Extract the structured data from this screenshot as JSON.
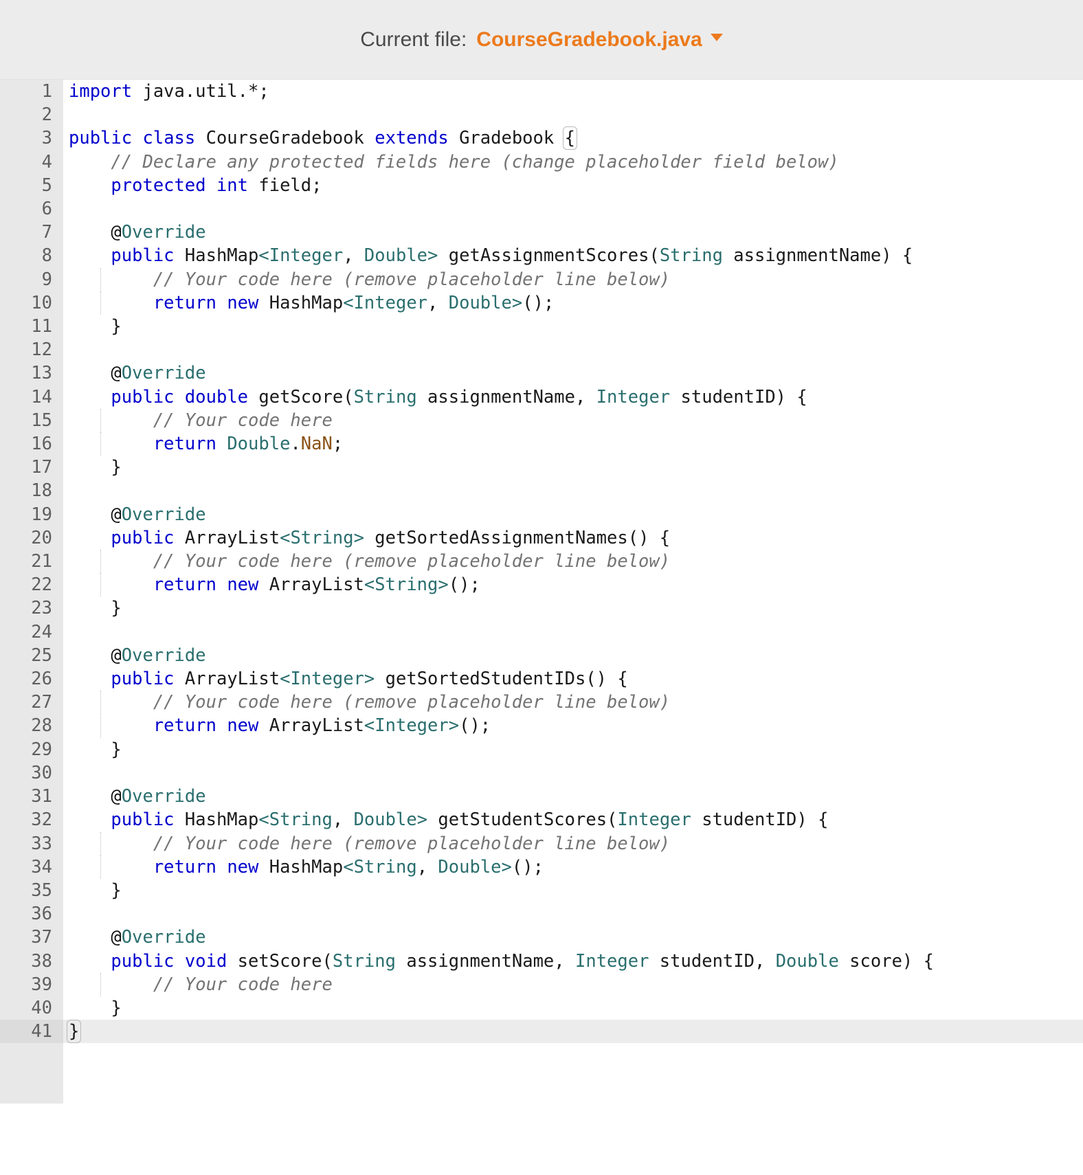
{
  "header": {
    "label": "Current file:",
    "file_name": "CourseGradebook.java",
    "caret_icon": "chevron-down-icon",
    "accent_color": "#ec7a1c",
    "background_color": "#ececec"
  },
  "editor": {
    "language": "java",
    "total_lines": 41,
    "active_line": 41,
    "gutter_background": "#e8e8e8",
    "colors": {
      "keyword": "#0000cd",
      "type": "#2a6e6e",
      "annotation": "#2a6e6e",
      "comment": "#737373",
      "constant": "#8a5316",
      "plain": "#1a1a1a"
    },
    "lines": [
      {
        "n": 1,
        "tokens": [
          {
            "t": "import",
            "c": "kw"
          },
          {
            "t": " java.util.*;",
            "c": "nrm"
          }
        ]
      },
      {
        "n": 2,
        "tokens": []
      },
      {
        "n": 3,
        "tokens": [
          {
            "t": "public",
            "c": "kw"
          },
          {
            "t": " ",
            "c": "nrm"
          },
          {
            "t": "class",
            "c": "kw"
          },
          {
            "t": " CourseGradebook ",
            "c": "nrm"
          },
          {
            "t": "extends",
            "c": "kw"
          },
          {
            "t": " Gradebook ",
            "c": "nrm"
          },
          {
            "t": "{",
            "c": "brk"
          }
        ]
      },
      {
        "n": 4,
        "tokens": [
          {
            "t": "    // Declare any protected fields here (change placeholder field below)",
            "c": "cmt"
          }
        ]
      },
      {
        "n": 5,
        "tokens": [
          {
            "t": "    ",
            "c": "nrm"
          },
          {
            "t": "protected",
            "c": "kw"
          },
          {
            "t": " ",
            "c": "nrm"
          },
          {
            "t": "int",
            "c": "kw"
          },
          {
            "t": " field;",
            "c": "nrm"
          }
        ]
      },
      {
        "n": 6,
        "tokens": []
      },
      {
        "n": 7,
        "tokens": [
          {
            "t": "    ",
            "c": "nrm"
          },
          {
            "t": "@",
            "c": "at"
          },
          {
            "t": "Override",
            "c": "ann"
          }
        ]
      },
      {
        "n": 8,
        "tokens": [
          {
            "t": "    ",
            "c": "nrm"
          },
          {
            "t": "public",
            "c": "kw"
          },
          {
            "t": " HashMap",
            "c": "nrm"
          },
          {
            "t": "<",
            "c": "typ"
          },
          {
            "t": "Integer",
            "c": "typ"
          },
          {
            "t": ", ",
            "c": "nrm"
          },
          {
            "t": "Double",
            "c": "typ"
          },
          {
            "t": ">",
            "c": "typ"
          },
          {
            "t": " getAssignmentScores(",
            "c": "nrm"
          },
          {
            "t": "String",
            "c": "typ"
          },
          {
            "t": " assignmentName) {",
            "c": "nrm"
          }
        ]
      },
      {
        "n": 9,
        "tokens": [
          {
            "t": "        // Your code here (remove placeholder line below)",
            "c": "cmt"
          }
        ]
      },
      {
        "n": 10,
        "tokens": [
          {
            "t": "        ",
            "c": "nrm"
          },
          {
            "t": "return",
            "c": "kw"
          },
          {
            "t": " ",
            "c": "nrm"
          },
          {
            "t": "new",
            "c": "kw"
          },
          {
            "t": " HashMap",
            "c": "nrm"
          },
          {
            "t": "<",
            "c": "typ"
          },
          {
            "t": "Integer",
            "c": "typ"
          },
          {
            "t": ", ",
            "c": "nrm"
          },
          {
            "t": "Double",
            "c": "typ"
          },
          {
            "t": ">",
            "c": "typ"
          },
          {
            "t": "();",
            "c": "nrm"
          }
        ]
      },
      {
        "n": 11,
        "tokens": [
          {
            "t": "    }",
            "c": "nrm"
          }
        ]
      },
      {
        "n": 12,
        "tokens": []
      },
      {
        "n": 13,
        "tokens": [
          {
            "t": "    ",
            "c": "nrm"
          },
          {
            "t": "@",
            "c": "at"
          },
          {
            "t": "Override",
            "c": "ann"
          }
        ]
      },
      {
        "n": 14,
        "tokens": [
          {
            "t": "    ",
            "c": "nrm"
          },
          {
            "t": "public",
            "c": "kw"
          },
          {
            "t": " ",
            "c": "nrm"
          },
          {
            "t": "double",
            "c": "kw"
          },
          {
            "t": " getScore(",
            "c": "nrm"
          },
          {
            "t": "String",
            "c": "typ"
          },
          {
            "t": " assignmentName, ",
            "c": "nrm"
          },
          {
            "t": "Integer",
            "c": "typ"
          },
          {
            "t": " studentID) {",
            "c": "nrm"
          }
        ]
      },
      {
        "n": 15,
        "tokens": [
          {
            "t": "        // Your code here",
            "c": "cmt"
          }
        ]
      },
      {
        "n": 16,
        "tokens": [
          {
            "t": "        ",
            "c": "nrm"
          },
          {
            "t": "return",
            "c": "kw"
          },
          {
            "t": " ",
            "c": "nrm"
          },
          {
            "t": "Double",
            "c": "typ"
          },
          {
            "t": ".",
            "c": "nrm"
          },
          {
            "t": "NaN",
            "c": "cst"
          },
          {
            "t": ";",
            "c": "nrm"
          }
        ]
      },
      {
        "n": 17,
        "tokens": [
          {
            "t": "    }",
            "c": "nrm"
          }
        ]
      },
      {
        "n": 18,
        "tokens": []
      },
      {
        "n": 19,
        "tokens": [
          {
            "t": "    ",
            "c": "nrm"
          },
          {
            "t": "@",
            "c": "at"
          },
          {
            "t": "Override",
            "c": "ann"
          }
        ]
      },
      {
        "n": 20,
        "tokens": [
          {
            "t": "    ",
            "c": "nrm"
          },
          {
            "t": "public",
            "c": "kw"
          },
          {
            "t": " ArrayList",
            "c": "nrm"
          },
          {
            "t": "<",
            "c": "typ"
          },
          {
            "t": "String",
            "c": "typ"
          },
          {
            "t": ">",
            "c": "typ"
          },
          {
            "t": " getSortedAssignmentNames() {",
            "c": "nrm"
          }
        ]
      },
      {
        "n": 21,
        "tokens": [
          {
            "t": "        // Your code here (remove placeholder line below)",
            "c": "cmt"
          }
        ]
      },
      {
        "n": 22,
        "tokens": [
          {
            "t": "        ",
            "c": "nrm"
          },
          {
            "t": "return",
            "c": "kw"
          },
          {
            "t": " ",
            "c": "nrm"
          },
          {
            "t": "new",
            "c": "kw"
          },
          {
            "t": " ArrayList",
            "c": "nrm"
          },
          {
            "t": "<",
            "c": "typ"
          },
          {
            "t": "String",
            "c": "typ"
          },
          {
            "t": ">",
            "c": "typ"
          },
          {
            "t": "();",
            "c": "nrm"
          }
        ]
      },
      {
        "n": 23,
        "tokens": [
          {
            "t": "    }",
            "c": "nrm"
          }
        ]
      },
      {
        "n": 24,
        "tokens": []
      },
      {
        "n": 25,
        "tokens": [
          {
            "t": "    ",
            "c": "nrm"
          },
          {
            "t": "@",
            "c": "at"
          },
          {
            "t": "Override",
            "c": "ann"
          }
        ]
      },
      {
        "n": 26,
        "tokens": [
          {
            "t": "    ",
            "c": "nrm"
          },
          {
            "t": "public",
            "c": "kw"
          },
          {
            "t": " ArrayList",
            "c": "nrm"
          },
          {
            "t": "<",
            "c": "typ"
          },
          {
            "t": "Integer",
            "c": "typ"
          },
          {
            "t": ">",
            "c": "typ"
          },
          {
            "t": " getSortedStudentIDs() {",
            "c": "nrm"
          }
        ]
      },
      {
        "n": 27,
        "tokens": [
          {
            "t": "        // Your code here (remove placeholder line below)",
            "c": "cmt"
          }
        ]
      },
      {
        "n": 28,
        "tokens": [
          {
            "t": "        ",
            "c": "nrm"
          },
          {
            "t": "return",
            "c": "kw"
          },
          {
            "t": " ",
            "c": "nrm"
          },
          {
            "t": "new",
            "c": "kw"
          },
          {
            "t": " ArrayList",
            "c": "nrm"
          },
          {
            "t": "<",
            "c": "typ"
          },
          {
            "t": "Integer",
            "c": "typ"
          },
          {
            "t": ">",
            "c": "typ"
          },
          {
            "t": "();",
            "c": "nrm"
          }
        ]
      },
      {
        "n": 29,
        "tokens": [
          {
            "t": "    }",
            "c": "nrm"
          }
        ]
      },
      {
        "n": 30,
        "tokens": []
      },
      {
        "n": 31,
        "tokens": [
          {
            "t": "    ",
            "c": "nrm"
          },
          {
            "t": "@",
            "c": "at"
          },
          {
            "t": "Override",
            "c": "ann"
          }
        ]
      },
      {
        "n": 32,
        "tokens": [
          {
            "t": "    ",
            "c": "nrm"
          },
          {
            "t": "public",
            "c": "kw"
          },
          {
            "t": " HashMap",
            "c": "nrm"
          },
          {
            "t": "<",
            "c": "typ"
          },
          {
            "t": "String",
            "c": "typ"
          },
          {
            "t": ", ",
            "c": "nrm"
          },
          {
            "t": "Double",
            "c": "typ"
          },
          {
            "t": ">",
            "c": "typ"
          },
          {
            "t": " getStudentScores(",
            "c": "nrm"
          },
          {
            "t": "Integer",
            "c": "typ"
          },
          {
            "t": " studentID) {",
            "c": "nrm"
          }
        ]
      },
      {
        "n": 33,
        "tokens": [
          {
            "t": "        // Your code here (remove placeholder line below)",
            "c": "cmt"
          }
        ]
      },
      {
        "n": 34,
        "tokens": [
          {
            "t": "        ",
            "c": "nrm"
          },
          {
            "t": "return",
            "c": "kw"
          },
          {
            "t": " ",
            "c": "nrm"
          },
          {
            "t": "new",
            "c": "kw"
          },
          {
            "t": " HashMap",
            "c": "nrm"
          },
          {
            "t": "<",
            "c": "typ"
          },
          {
            "t": "String",
            "c": "typ"
          },
          {
            "t": ", ",
            "c": "nrm"
          },
          {
            "t": "Double",
            "c": "typ"
          },
          {
            "t": ">",
            "c": "typ"
          },
          {
            "t": "();",
            "c": "nrm"
          }
        ]
      },
      {
        "n": 35,
        "tokens": [
          {
            "t": "    }",
            "c": "nrm"
          }
        ]
      },
      {
        "n": 36,
        "tokens": []
      },
      {
        "n": 37,
        "tokens": [
          {
            "t": "    ",
            "c": "nrm"
          },
          {
            "t": "@",
            "c": "at"
          },
          {
            "t": "Override",
            "c": "ann"
          }
        ]
      },
      {
        "n": 38,
        "tokens": [
          {
            "t": "    ",
            "c": "nrm"
          },
          {
            "t": "public",
            "c": "kw"
          },
          {
            "t": " ",
            "c": "nrm"
          },
          {
            "t": "void",
            "c": "kw"
          },
          {
            "t": " setScore(",
            "c": "nrm"
          },
          {
            "t": "String",
            "c": "typ"
          },
          {
            "t": " assignmentName, ",
            "c": "nrm"
          },
          {
            "t": "Integer",
            "c": "typ"
          },
          {
            "t": " studentID, ",
            "c": "nrm"
          },
          {
            "t": "Double",
            "c": "typ"
          },
          {
            "t": " score) {",
            "c": "nrm"
          }
        ]
      },
      {
        "n": 39,
        "tokens": [
          {
            "t": "        // Your code here",
            "c": "cmt"
          }
        ]
      },
      {
        "n": 40,
        "tokens": [
          {
            "t": "    }",
            "c": "nrm"
          }
        ]
      },
      {
        "n": 41,
        "tokens": [
          {
            "t": "}",
            "c": "brk"
          }
        ]
      }
    ]
  }
}
